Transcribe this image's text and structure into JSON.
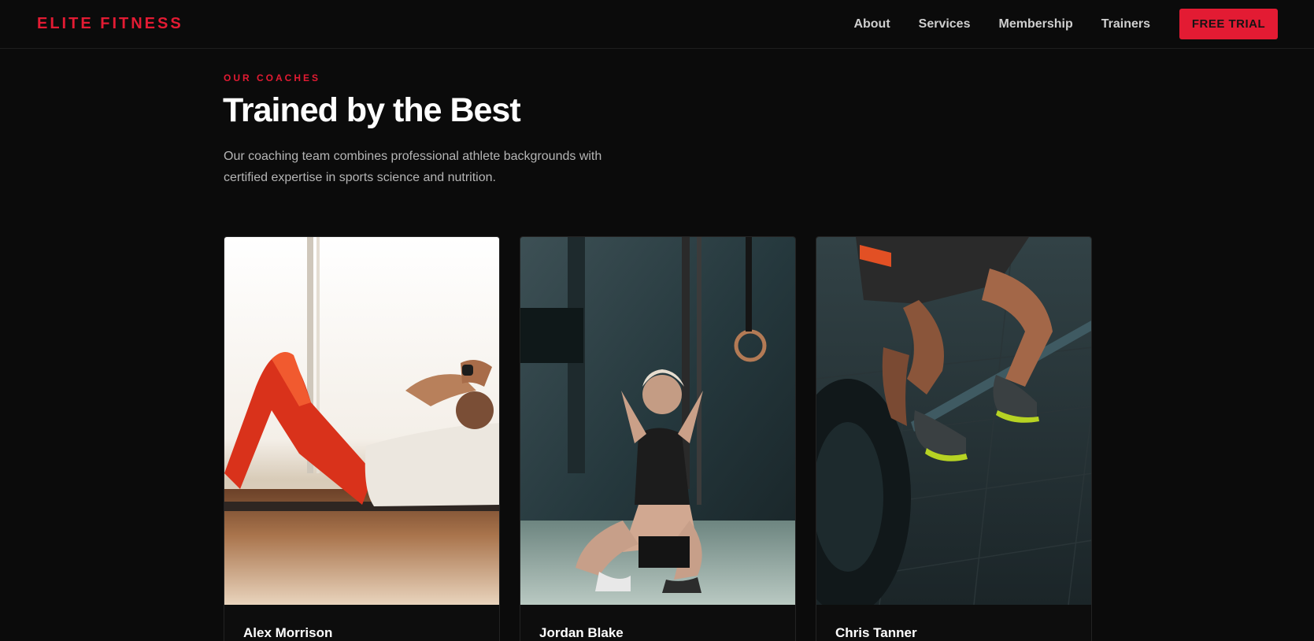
{
  "nav": {
    "logo": "ELITE FITNESS",
    "links": [
      "About",
      "Services",
      "Membership",
      "Trainers"
    ],
    "cta": "FREE TRIAL"
  },
  "section": {
    "eyebrow": "OUR COACHES",
    "title": "Trained by the Best",
    "description": "Our coaching team combines professional athlete backgrounds with certified expertise in sports science and nutrition."
  },
  "trainers": [
    {
      "name": "Alex Morrison"
    },
    {
      "name": "Jordan Blake"
    },
    {
      "name": "Chris Tanner"
    }
  ],
  "colors": {
    "accent": "#e31b33",
    "background": "#0b0b0b",
    "text_muted": "#b5b5b5"
  }
}
